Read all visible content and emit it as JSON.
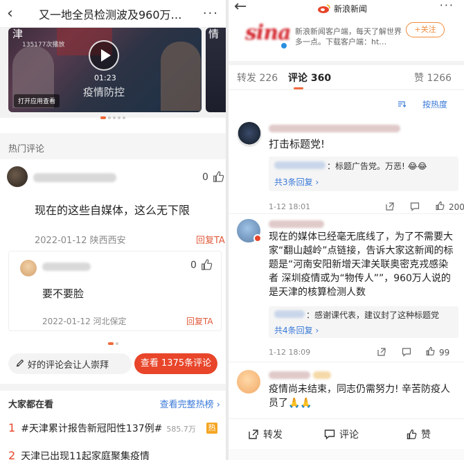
{
  "left": {
    "header": {
      "title": "又一地全员检测波及960万…",
      "back": "‹",
      "more": "···"
    },
    "video": {
      "corner_text": "津",
      "plays": "135177次播放",
      "duration": "01:23",
      "watermark": "疫情防控",
      "open_app": "打开应用查看",
      "second_corner": "情"
    },
    "hot_comments_label": "热门评论",
    "comment1": {
      "likes": "0",
      "text": "现在的这些自媒体，这么无下限",
      "date": "2022-01-12 陕西西安",
      "reply": "回复TA"
    },
    "comment2": {
      "likes": "0",
      "text": "要不要脸",
      "date": "2022-01-12 河北保定",
      "reply": "回复TA"
    },
    "input_placeholder": "好的评论会让人崇拜",
    "view_all": "查看 1375条评论",
    "everyone_watching": "大家都在看",
    "view_full_list": "查看完整热榜 ›",
    "hot_items": [
      {
        "rank": "1",
        "title": "#天津累计报告新冠阳性137例#",
        "count": "585.7万",
        "tag": "热"
      },
      {
        "rank": "2",
        "title": "天津已出现11起家庭聚集疫情"
      }
    ]
  },
  "right": {
    "header": {
      "back": "←",
      "name": "新浪新闻",
      "more": "···"
    },
    "card": {
      "logo_text": "sina",
      "desc": "新浪新闻客户端，每天了解世界多一点。下载客户端：ht…",
      "follow": "+关注"
    },
    "tabs": [
      {
        "label": "转发 226"
      },
      {
        "label": "评论 360"
      },
      {
        "label": "赞 1266"
      }
    ],
    "sort": "按热度",
    "comments": [
      {
        "text": "打击标题党!",
        "sub_text": "：标题广告党。万恶! 😂😂",
        "more": "共3条回复 ›",
        "time": "1-12 18:01",
        "likes": "200"
      },
      {
        "text": "现在的媒体已经毫无底线了，为了不需要大家“翻山越岭”点链接，告诉大家这新闻的标题是“河南安阳新增天津关联奥密克戎感染者 深圳疫情或为“物传人””，960万人说的是天津的核算检测人数",
        "sub_text": "：感谢课代表，建议封了这种标题党",
        "more": "共4条回复 ›",
        "time": "1-12 18:09",
        "likes": "99"
      },
      {
        "text": "疫情尚未结束，同志仍需努力! 辛苦防疫人员了🙏🙏"
      }
    ],
    "footer": {
      "repost": "转发",
      "comment": "评论",
      "like": "赞"
    }
  }
}
